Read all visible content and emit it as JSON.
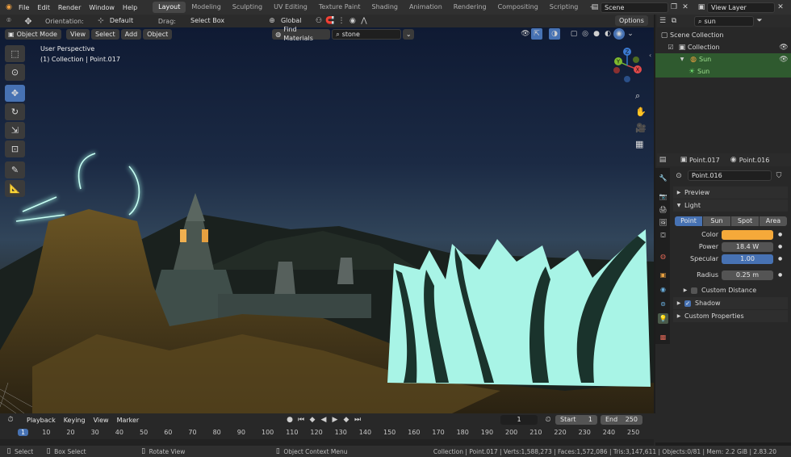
{
  "menubar": {
    "menus": [
      "File",
      "Edit",
      "Render",
      "Window",
      "Help"
    ],
    "workspaces": [
      "Layout",
      "Modeling",
      "Sculpting",
      "UV Editing",
      "Texture Paint",
      "Shading",
      "Animation",
      "Rendering",
      "Compositing",
      "Scripting"
    ],
    "active_workspace": "Layout",
    "add_tab": "+",
    "scene": "Scene",
    "view_layer": "View Layer"
  },
  "toolheader": {
    "orientation_label": "Orientation:",
    "orientation_value": "Default",
    "drag_label": "Drag:",
    "drag_value": "Select Box",
    "transform_orientation": "Global",
    "options": "Options"
  },
  "viewheader": {
    "mode": "Object Mode",
    "menus": [
      "View",
      "Select",
      "Add",
      "Object"
    ],
    "find_materials": "Find Materials",
    "search_value": "stone"
  },
  "viewport": {
    "perspective": "User Perspective",
    "context": "(1) Collection | Point.017",
    "gizmo": {
      "x": "X",
      "y": "Y",
      "z": "Z"
    }
  },
  "outliner": {
    "search_value": "sun",
    "items": [
      {
        "label": "Scene Collection"
      },
      {
        "label": "Collection"
      },
      {
        "label": "Sun"
      },
      {
        "label": "Sun"
      }
    ]
  },
  "properties": {
    "breadcrumb_object": "Point.017",
    "breadcrumb_data": "Point.016",
    "datablock": "Point.016",
    "panels": {
      "preview": "Preview",
      "light": "Light",
      "custom_distance": "Custom Distance",
      "shadow": "Shadow",
      "custom_properties": "Custom Properties"
    },
    "light_types": [
      "Point",
      "Sun",
      "Spot",
      "Area"
    ],
    "active_light_type": "Point",
    "color_label": "Color",
    "color_value": "#f5a93a",
    "power_label": "Power",
    "power_value": "18.4 W",
    "specular_label": "Specular",
    "specular_value": "1.00",
    "radius_label": "Radius",
    "radius_value": "0.25 m",
    "shadow_checked": true,
    "custom_distance_checked": false
  },
  "timeline": {
    "menus": [
      "Playback",
      "Keying",
      "View",
      "Marker"
    ],
    "current_frame": "1",
    "start_label": "Start",
    "start_value": "1",
    "end_label": "End",
    "end_value": "250",
    "ruler": [
      "1",
      "10",
      "20",
      "30",
      "40",
      "50",
      "60",
      "70",
      "80",
      "90",
      "100",
      "110",
      "120",
      "130",
      "140",
      "150",
      "160",
      "170",
      "180",
      "190",
      "200",
      "210",
      "220",
      "230",
      "240",
      "250"
    ]
  },
  "statusbar": {
    "hints": [
      "Select",
      "Box Select",
      "Rotate View",
      "Object Context Menu"
    ],
    "info": "Collection | Point.017 | Verts:1,588,273 | Faces:1,572,086 | Tris:3,147,611 | Objects:0/81 | Mem: 2.2 GiB | 2.83.20"
  },
  "colors": {
    "accent": "#4772b3",
    "active_tab": "#474747",
    "outliner_highlight": "#2f5a2f",
    "glow": "#a8f4e6"
  }
}
